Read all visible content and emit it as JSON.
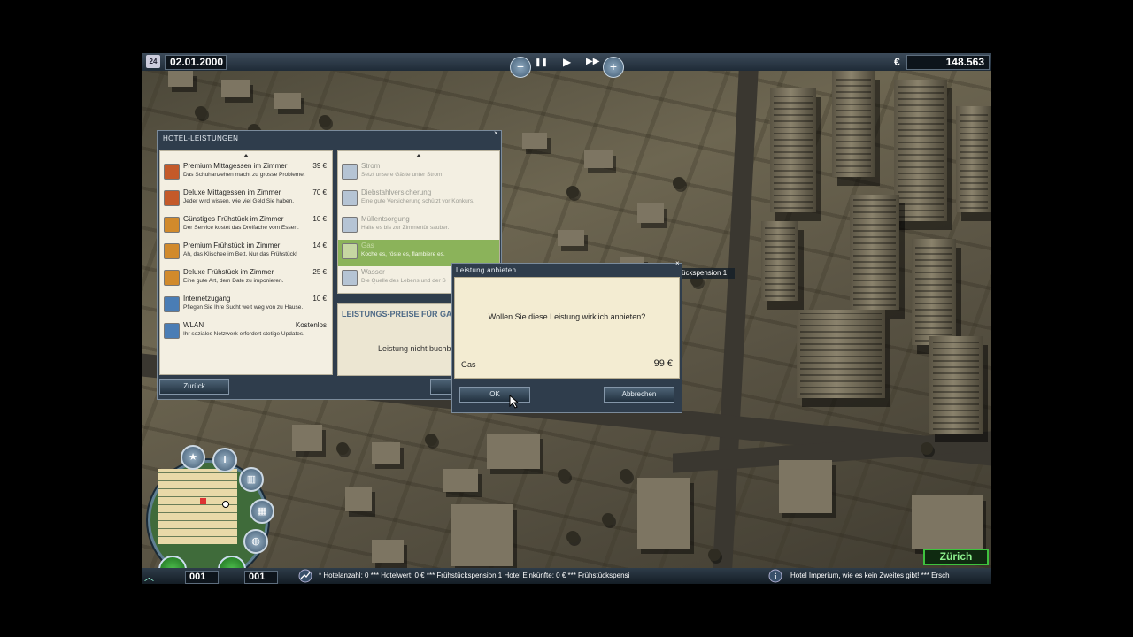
{
  "topbar": {
    "date_icon": "24",
    "date": "02.01.2000",
    "zoom_out": "−",
    "zoom_in": "+",
    "pause": "❚❚",
    "play": "▶",
    "fast": "▶▶",
    "currency": "€",
    "money": "148.563"
  },
  "services_panel": {
    "title": "HOTEL-LEISTUNGEN",
    "left_list": [
      {
        "name": "Premium Mittagessen im Zimmer",
        "desc": "Das Schuhanzehen macht zu grosse Probleme.",
        "price": "39 €",
        "icon": "meal-icon"
      },
      {
        "name": "Deluxe Mittagessen im Zimmer",
        "desc": "Jeder wird wissen, wie viel Geld Sie haben.",
        "price": "70 €",
        "icon": "meal-icon"
      },
      {
        "name": "Günstiges Frühstück im Zimmer",
        "desc": "Der Service kostet das Dreifache vom Essen.",
        "price": "10 €",
        "icon": "breakfast-icon"
      },
      {
        "name": "Premium Frühstück im Zimmer",
        "desc": "Ah, das Klischee im Bett. Nur das Frühstück!",
        "price": "14 €",
        "icon": "breakfast-icon"
      },
      {
        "name": "Deluxe Frühstück im Zimmer",
        "desc": "Eine gute Art, dem Date zu imponieren.",
        "price": "25 €",
        "icon": "breakfast-icon"
      },
      {
        "name": "Internetzugang",
        "desc": "Pflegen Sie Ihre Sucht weit weg von zu Hause.",
        "price": "10 €",
        "icon": "internet-icon"
      },
      {
        "name": "WLAN",
        "desc": "Ihr soziales Netzwerk erfordert stetige Updates.",
        "price": "Kostenlos",
        "icon": "wlan-icon"
      }
    ],
    "right_list": [
      {
        "name": "Strom",
        "desc": "Setzt unsere Gäste unter Strom.",
        "icon": "power-icon",
        "state": "disabled"
      },
      {
        "name": "Diebstahlversicherung",
        "desc": "Eine gute Versicherung schützt vor Konkurs.",
        "icon": "insurance-icon",
        "state": "disabled"
      },
      {
        "name": "Müllentsorgung",
        "desc": "Halte es bis zur Zimmertür sauber.",
        "icon": "waste-icon",
        "state": "disabled"
      },
      {
        "name": "Gas",
        "desc": "Koche es, röste es, flambiere es.",
        "icon": "gas-icon",
        "state": "selected"
      },
      {
        "name": "Wasser",
        "desc": "Die Quelle des Lebens und der S",
        "icon": "water-icon",
        "state": "disabled"
      }
    ],
    "prices_title": "LEISTUNGS-PREISE FÜR GA",
    "prices_status": "Leistung nicht buchb",
    "back_button": "Zurück"
  },
  "hotel_label": "ückspension 1",
  "dialog": {
    "title": "Leistung anbieten",
    "question": "Wollen Sie diese Leistung wirklich anbieten?",
    "item": "Gas",
    "price": "99 €",
    "ok": "OK",
    "cancel": "Abbrechen"
  },
  "minimap": {
    "star": "★",
    "info": "i",
    "counter_left": "001",
    "counter_right": "001"
  },
  "city_label": "Zürich",
  "bottombar": {
    "ticker1": "*      Hotelanzahl: 0        ***       Hotelwert: 0 €        ***       Frühstückspension 1 Hotel Einkünfte: 0 €        ***       Frühstückspensi",
    "ticker2": "Hotel Imperium, wie es kein Zweites gibt!        ***       Ersch"
  }
}
